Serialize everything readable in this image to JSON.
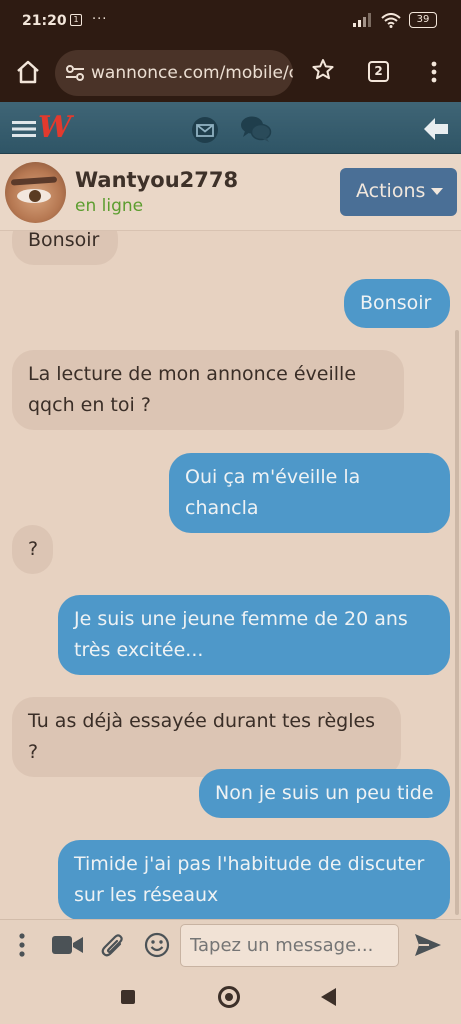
{
  "status_bar": {
    "time": "21:20",
    "notification_icon": "1",
    "more_dots": "···",
    "battery": "39"
  },
  "browser": {
    "url": "wannonce.com/mobile/c",
    "tab_count": "2"
  },
  "app": {
    "logo": "W"
  },
  "contact": {
    "name": "Wantyou2778",
    "status": "en ligne",
    "actions_label": "Actions"
  },
  "messages": [
    {
      "dir": "in",
      "text": "Bonsoir"
    },
    {
      "dir": "out",
      "text": "Bonsoir"
    },
    {
      "dir": "in",
      "text": "La lecture de mon annonce éveille qqch en toi ?"
    },
    {
      "dir": "out",
      "text": "Oui ça m'éveille la chancla"
    },
    {
      "dir": "in",
      "text": "?"
    },
    {
      "dir": "out",
      "text": "Je suis une jeune femme de 20 ans très excitée..."
    },
    {
      "dir": "in",
      "text": "Tu as déjà essayée durant tes règles ?"
    },
    {
      "dir": "out",
      "text": "Non je suis un peu tide"
    },
    {
      "dir": "out",
      "text": "Timide j'ai pas l'habitude de discuter sur les réseaux"
    }
  ],
  "composer": {
    "placeholder": "Tapez un message..."
  },
  "colors": {
    "incoming_bubble": "#dcc5b4",
    "outgoing_bubble": "#4e98c9",
    "online_status": "#5c9d2f",
    "actions_button": "#4a6f96",
    "logo_red": "#e23a2e"
  }
}
